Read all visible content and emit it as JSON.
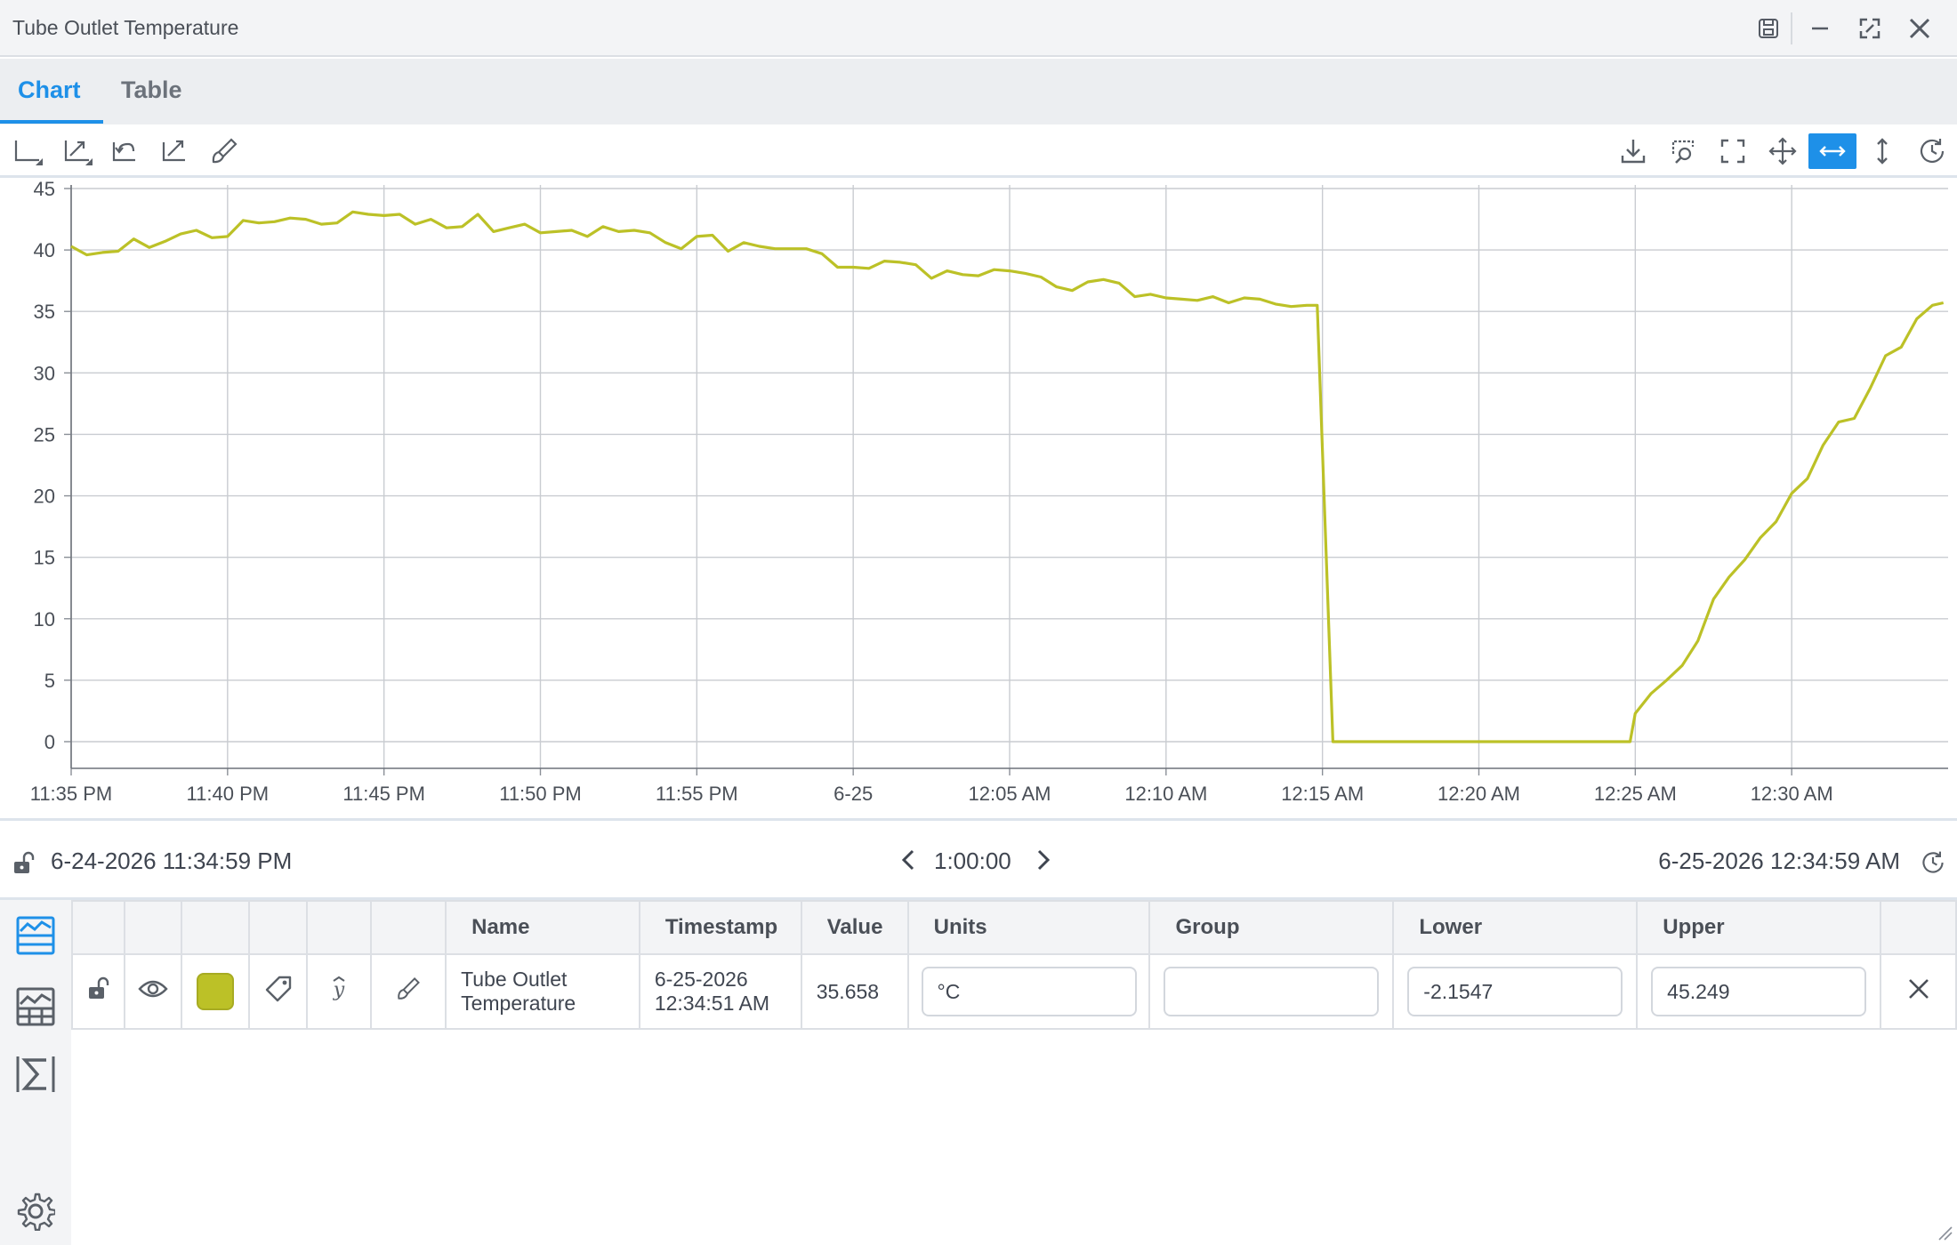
{
  "window": {
    "title": "Tube Outlet Temperature"
  },
  "tabs": [
    {
      "label": "Chart",
      "active": true
    },
    {
      "label": "Table",
      "active": false
    }
  ],
  "colors": {
    "accent": "#1e90e8",
    "series": "#bcc127"
  },
  "toolbar": {
    "left_icons": [
      "axis-icon",
      "axis-scale-icon",
      "undo-zoom-icon",
      "autoscale-icon",
      "brush-icon"
    ],
    "right_icons": [
      "download-icon",
      "zoom-select-icon",
      "fullscreen-icon",
      "pan-icon",
      "horizontal-zoom-icon",
      "vertical-zoom-icon",
      "history-icon"
    ],
    "active": "horizontal-zoom-icon"
  },
  "range": {
    "start": "6-24-2026 11:34:59 PM",
    "duration": "1:00:00",
    "end": "6-25-2026 12:34:59 AM"
  },
  "table": {
    "headers": [
      "Name",
      "Timestamp",
      "Value",
      "Units",
      "Group",
      "Lower",
      "Upper"
    ],
    "row": {
      "name": "Tube Outlet Temperature",
      "name_line1": "Tube Outlet",
      "name_line2": "Temperature",
      "timestamp_line1": "6-25-2026",
      "timestamp_line2": "12:34:51 AM",
      "value": "35.658",
      "units": "°C",
      "group": "",
      "lower": "-2.1547",
      "upper": "45.249"
    }
  },
  "chart_data": {
    "type": "line",
    "title": "",
    "xlabel": "",
    "ylabel": "",
    "ylim": [
      0,
      45
    ],
    "yticks": [
      0,
      5,
      10,
      15,
      20,
      25,
      30,
      35,
      40,
      45
    ],
    "xlim": [
      "11:35 PM",
      "12:35 AM"
    ],
    "xtick_labels": [
      "11:35 PM",
      "11:40 PM",
      "11:45 PM",
      "11:50 PM",
      "11:55 PM",
      "6-25",
      "12:05 AM",
      "12:10 AM",
      "12:15 AM",
      "12:20 AM",
      "12:25 AM",
      "12:30 AM"
    ],
    "grid": true,
    "series": [
      {
        "color": "#bcc127",
        "x": [
          "11:35:00 PM",
          "11:35:30 PM",
          "11:36:00 PM",
          "11:36:30 PM",
          "11:37:00 PM",
          "11:37:30 PM",
          "11:38:00 PM",
          "11:38:30 PM",
          "11:39:00 PM",
          "11:39:30 PM",
          "11:40:00 PM",
          "11:40:30 PM",
          "11:41:00 PM",
          "11:41:30 PM",
          "11:42:00 PM",
          "11:42:30 PM",
          "11:43:00 PM",
          "11:43:30 PM",
          "11:44:00 PM",
          "11:44:30 PM",
          "11:45:00 PM",
          "11:45:30 PM",
          "11:46:00 PM",
          "11:46:30 PM",
          "11:47:00 PM",
          "11:47:30 PM",
          "11:48:00 PM",
          "11:48:30 PM",
          "11:49:00 PM",
          "11:49:30 PM",
          "11:50:00 PM",
          "11:50:30 PM",
          "11:51:00 PM",
          "11:51:30 PM",
          "11:52:00 PM",
          "11:52:30 PM",
          "11:53:00 PM",
          "11:53:30 PM",
          "11:54:00 PM",
          "11:54:30 PM",
          "11:55:00 PM",
          "11:55:30 PM",
          "11:56:00 PM",
          "11:56:30 PM",
          "11:57:00 PM",
          "11:57:30 PM",
          "11:58:00 PM",
          "11:58:30 PM",
          "11:59:00 PM",
          "11:59:30 PM",
          "12:00:00 AM",
          "12:00:30 AM",
          "12:01:00 AM",
          "12:01:30 AM",
          "12:02:00 AM",
          "12:02:30 AM",
          "12:03:00 AM",
          "12:03:30 AM",
          "12:04:00 AM",
          "12:04:30 AM",
          "12:05:00 AM",
          "12:05:30 AM",
          "12:06:00 AM",
          "12:06:30 AM",
          "12:07:00 AM",
          "12:07:30 AM",
          "12:08:00 AM",
          "12:08:30 AM",
          "12:09:00 AM",
          "12:09:30 AM",
          "12:10:00 AM",
          "12:10:30 AM",
          "12:11:00 AM",
          "12:11:30 AM",
          "12:12:00 AM",
          "12:12:30 AM",
          "12:13:00 AM",
          "12:13:30 AM",
          "12:14:00 AM",
          "12:14:30 AM",
          "12:14:50 AM",
          "12:15:20 AM",
          "12:20:00 AM",
          "12:24:50 AM",
          "12:25:00 AM",
          "12:25:30 AM",
          "12:26:00 AM",
          "12:26:30 AM",
          "12:27:00 AM",
          "12:27:30 AM",
          "12:28:00 AM",
          "12:28:30 AM",
          "12:29:00 AM",
          "12:29:30 AM",
          "12:30:00 AM",
          "12:30:30 AM",
          "12:31:00 AM",
          "12:31:30 AM",
          "12:32:00 AM",
          "12:32:30 AM",
          "12:33:00 AM",
          "12:33:30 AM",
          "12:34:00 AM",
          "12:34:30 AM",
          "12:34:51 AM"
        ],
        "values": [
          40.3,
          39.6,
          39.8,
          39.9,
          40.9,
          40.2,
          40.7,
          41.3,
          41.6,
          41.0,
          41.1,
          42.4,
          42.2,
          42.3,
          42.6,
          42.5,
          42.1,
          42.2,
          43.1,
          42.9,
          42.8,
          42.9,
          42.1,
          42.5,
          41.8,
          41.9,
          42.9,
          41.5,
          41.8,
          42.1,
          41.4,
          41.5,
          41.6,
          41.1,
          41.9,
          41.5,
          41.6,
          41.4,
          40.6,
          40.1,
          41.1,
          41.2,
          39.9,
          40.6,
          40.3,
          40.1,
          40.1,
          40.1,
          39.7,
          38.6,
          38.6,
          38.5,
          39.1,
          39.0,
          38.8,
          37.7,
          38.3,
          38.0,
          37.9,
          38.4,
          38.3,
          38.1,
          37.8,
          37.0,
          36.7,
          37.4,
          37.6,
          37.3,
          36.2,
          36.4,
          36.1,
          36.0,
          35.9,
          36.2,
          35.7,
          36.1,
          36.0,
          35.6,
          35.4,
          35.5,
          35.5,
          0.0,
          0.0,
          0.0,
          2.3,
          3.9,
          5.0,
          6.2,
          8.2,
          11.6,
          13.4,
          14.8,
          16.6,
          17.9,
          20.2,
          21.4,
          24.1,
          26.0,
          26.3,
          28.7,
          31.4,
          32.1,
          34.4,
          35.5,
          35.7
        ]
      }
    ]
  }
}
